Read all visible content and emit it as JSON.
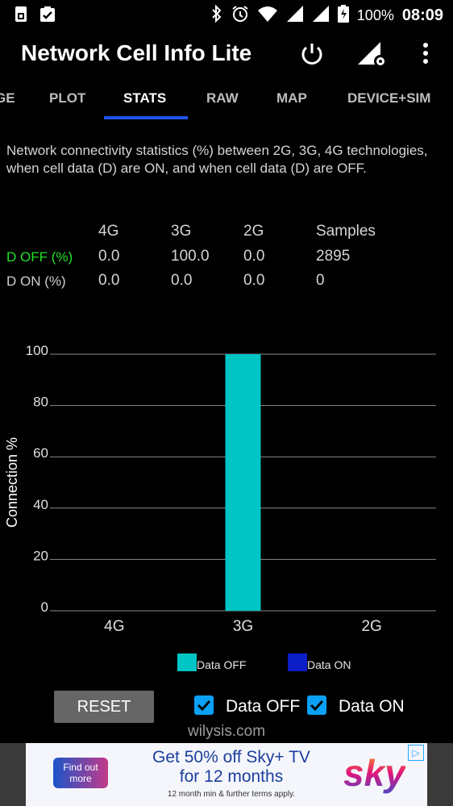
{
  "status_bar": {
    "battery": "100%",
    "time": "08:09",
    "icons": [
      "sim-icon",
      "clipboard-check-icon",
      "bluetooth-icon",
      "alarm-icon",
      "wifi-icon",
      "signal-icon",
      "signal-icon",
      "battery-charging-icon"
    ]
  },
  "toolbar": {
    "title": "Network Cell Info Lite",
    "icons": [
      "power-icon",
      "signal-settings-icon",
      "more-vert-icon"
    ]
  },
  "tabs": [
    {
      "label": "GE",
      "active": false
    },
    {
      "label": "PLOT",
      "active": false
    },
    {
      "label": "STATS",
      "active": true
    },
    {
      "label": "RAW",
      "active": false
    },
    {
      "label": "MAP",
      "active": false
    },
    {
      "label": "DEVICE+SIM",
      "active": false
    }
  ],
  "description": "Network connectivity statistics (%) between 2G, 3G, 4G technologies, when cell data (D) are ON, and when cell data (D) are OFF.",
  "stats_table": {
    "headers": [
      "4G",
      "3G",
      "2G",
      "Samples"
    ],
    "rows": [
      {
        "label": "D OFF (%)",
        "values": [
          "0.0",
          "100.0",
          "0.0",
          "2895"
        ]
      },
      {
        "label": "D ON (%)",
        "values": [
          "0.0",
          "0.0",
          "0.0",
          "0"
        ]
      }
    ]
  },
  "chart_data": {
    "type": "bar",
    "categories": [
      "4G",
      "3G",
      "2G"
    ],
    "series": [
      {
        "name": "Data OFF",
        "values": [
          0,
          100,
          0
        ],
        "color": "#00c5c5"
      },
      {
        "name": "Data ON",
        "values": [
          0,
          0,
          0
        ],
        "color": "#0c1ec8"
      }
    ],
    "ylabel": "Connection %",
    "ylim": [
      0,
      100
    ],
    "yticks": [
      "0",
      "20",
      "40",
      "60",
      "80",
      "100"
    ],
    "grid": true,
    "legend": "bottom"
  },
  "controls": {
    "reset_label": "RESET",
    "data_off_label": "Data OFF",
    "data_on_label": "Data ON",
    "data_off_checked": true,
    "data_on_checked": true
  },
  "footer": "wilysis.com",
  "ad": {
    "button": "Find out more",
    "line1": "Get 50% off Sky+ TV",
    "line2": "for 12 months",
    "small": "12 month min & further terms apply.",
    "logo": "sky"
  }
}
